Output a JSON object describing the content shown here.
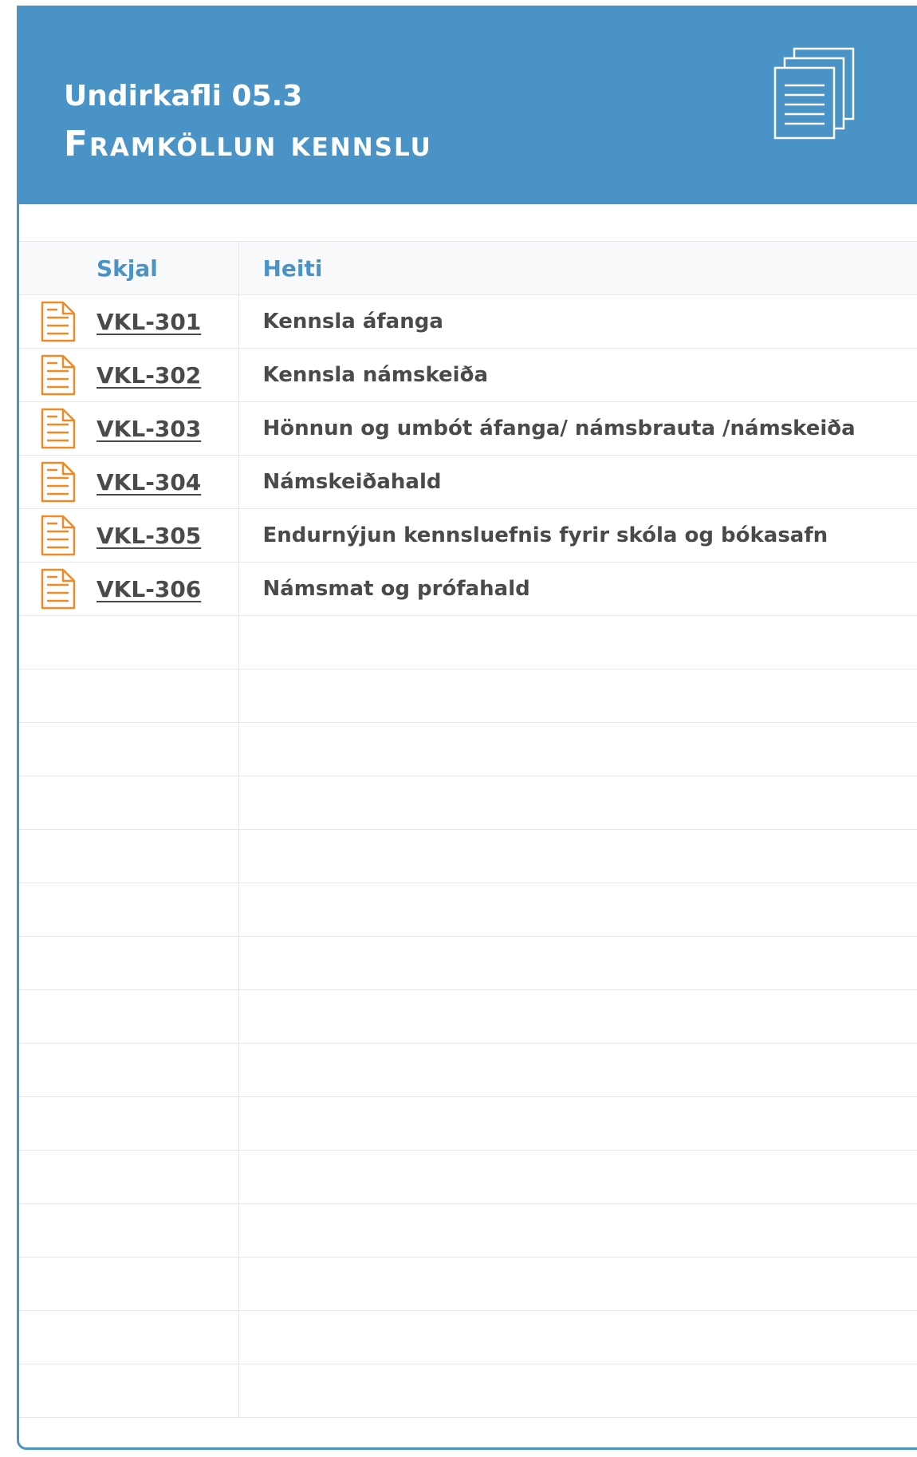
{
  "header": {
    "subtitle": "Undirkafli 05.3",
    "title": "Framköllun kennslu",
    "icon": "documents-icon",
    "background_color": "#4a93c6"
  },
  "table": {
    "columns": [
      "Skjal",
      "Heiti"
    ],
    "rows": [
      {
        "code": "VKL-301",
        "name": "Kennsla áfanga"
      },
      {
        "code": "VKL-302",
        "name": "Kennsla námskeiða"
      },
      {
        "code": "VKL-303",
        "name": "Hönnun og umbót áfanga/ námsbrauta /námskeiða"
      },
      {
        "code": "VKL-304",
        "name": "Námskeiðahald"
      },
      {
        "code": "VKL-305",
        "name": "Endurnýjun kennsluefnis fyrir skóla og bókasafn"
      },
      {
        "code": "VKL-306",
        "name": "Námsmat og prófahald"
      }
    ],
    "row_icon": "document-file-icon",
    "row_icon_color": "#f08a24",
    "empty_row_count": 15
  }
}
